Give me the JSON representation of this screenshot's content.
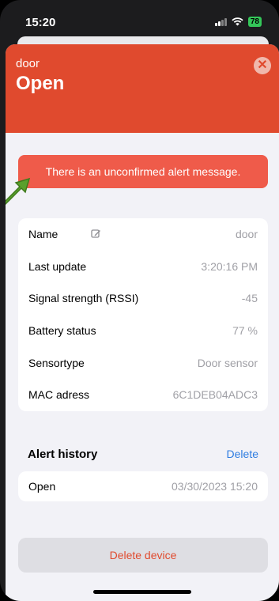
{
  "status_bar": {
    "time": "15:20",
    "battery": "78"
  },
  "header": {
    "device_name": "door",
    "state": "Open",
    "close_icon": "close-icon",
    "color": "#e04a2e"
  },
  "alert_banner": {
    "text": "There is an unconfirmed alert message.",
    "color": "#ef5b4a"
  },
  "details": [
    {
      "label": "Name",
      "value": "door",
      "editable": true
    },
    {
      "label": "Last update",
      "value": "3:20:16 PM"
    },
    {
      "label": "Signal strength (RSSI)",
      "value": "-45"
    },
    {
      "label": "Battery status",
      "value": "77 %"
    },
    {
      "label": "Sensortype",
      "value": "Door sensor"
    },
    {
      "label": "MAC adress",
      "value": "6C1DEB04ADC3"
    }
  ],
  "alert_history": {
    "title": "Alert history",
    "action_label": "Delete",
    "items": [
      {
        "event": "Open",
        "timestamp": "03/30/2023 15:20"
      }
    ]
  },
  "delete_device_label": "Delete device",
  "colors": {
    "accent": "#2f7de1",
    "destructive": "#e04a2e"
  }
}
